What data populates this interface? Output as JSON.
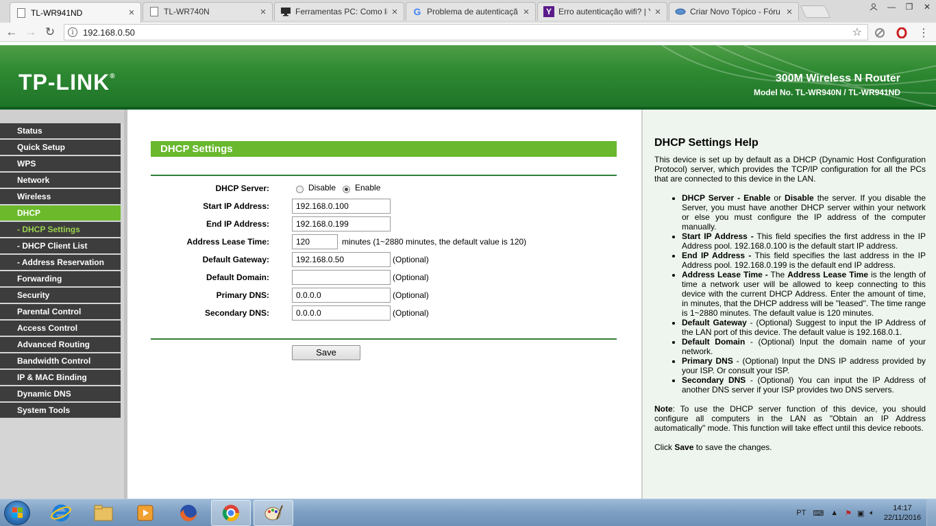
{
  "browser": {
    "tabs": [
      {
        "title": "TL-WR941ND",
        "active": true
      },
      {
        "title": "TL-WR740N",
        "active": false
      },
      {
        "title": "Ferramentas PC: Como li",
        "active": false
      },
      {
        "title": "Problema de autenticaçã",
        "active": false
      },
      {
        "title": "Erro autenticação wifi? | Y",
        "active": false
      },
      {
        "title": "Criar Novo Tópico - Fóru",
        "active": false
      }
    ],
    "address": "192.168.0.50"
  },
  "header": {
    "logo": "TP-LINK",
    "logo_mark": "®",
    "product": "300M Wireless N Router",
    "model": "Model No. TL-WR940N / TL-WR941ND"
  },
  "nav": {
    "items": [
      {
        "label": "Status",
        "sub": false,
        "active": false
      },
      {
        "label": "Quick Setup",
        "sub": false,
        "active": false
      },
      {
        "label": "WPS",
        "sub": false,
        "active": false
      },
      {
        "label": "Network",
        "sub": false,
        "active": false
      },
      {
        "label": "Wireless",
        "sub": false,
        "active": false
      },
      {
        "label": "DHCP",
        "sub": false,
        "active": true
      },
      {
        "label": "- DHCP Settings",
        "sub": true,
        "active": true
      },
      {
        "label": "- DHCP Client List",
        "sub": true,
        "active": false
      },
      {
        "label": "- Address Reservation",
        "sub": true,
        "active": false
      },
      {
        "label": "Forwarding",
        "sub": false,
        "active": false
      },
      {
        "label": "Security",
        "sub": false,
        "active": false
      },
      {
        "label": "Parental Control",
        "sub": false,
        "active": false
      },
      {
        "label": "Access Control",
        "sub": false,
        "active": false
      },
      {
        "label": "Advanced Routing",
        "sub": false,
        "active": false
      },
      {
        "label": "Bandwidth Control",
        "sub": false,
        "active": false
      },
      {
        "label": "IP & MAC Binding",
        "sub": false,
        "active": false
      },
      {
        "label": "Dynamic DNS",
        "sub": false,
        "active": false
      },
      {
        "label": "System Tools",
        "sub": false,
        "active": false
      }
    ]
  },
  "form": {
    "title": "DHCP Settings",
    "dhcp_server_label": "DHCP Server:",
    "disable_label": "Disable",
    "enable_label": "Enable",
    "dhcp_server_value": "Enable",
    "start_ip_label": "Start IP Address:",
    "start_ip": "192.168.0.100",
    "end_ip_label": "End IP Address:",
    "end_ip": "192.168.0.199",
    "lease_label": "Address Lease Time:",
    "lease": "120",
    "lease_note": "minutes (1~2880 minutes, the default value is 120)",
    "gateway_label": "Default Gateway:",
    "gateway": "192.168.0.50",
    "domain_label": "Default Domain:",
    "domain": "",
    "primary_dns_label": "Primary DNS:",
    "primary_dns": "0.0.0.0",
    "secondary_dns_label": "Secondary DNS:",
    "secondary_dns": "0.0.0.0",
    "optional": "(Optional)",
    "save_label": "Save"
  },
  "help": {
    "title": "DHCP Settings Help",
    "intro": "This device is set up by default as a DHCP (Dynamic Host Configuration Protocol) server, which provides the TCP/IP configuration for all the PCs that are connected to this device in the LAN.",
    "items": [
      {
        "term": "DHCP Server - Enable",
        "mid": " or ",
        "term2": "Disable",
        "text": " the server. If you disable the Server, you must have another DHCP server within your network or else you must configure the IP address of the computer manually."
      },
      {
        "term": "Start IP Address -",
        "mid": "",
        "term2": "",
        "text": " This field specifies the first address in the IP Address pool. 192.168.0.100 is the default start IP address."
      },
      {
        "term": "End IP Address -",
        "mid": "",
        "term2": "",
        "text": " This field specifies the last address in the IP Address pool. 192.168.0.199 is the default end IP address."
      },
      {
        "term": "Address Lease Time -",
        "mid": " The ",
        "term2": "Address Lease Time",
        "text": " is the length of time a network user will be allowed to keep connecting to this device with the current DHCP Address. Enter the amount of time, in minutes, that the DHCP address will be \"leased\". The time range is 1~2880 minutes. The default value is 120 minutes."
      },
      {
        "term": "Default Gateway",
        "mid": "",
        "term2": "",
        "text": " - (Optional) Suggest to input the IP Address of the LAN port of this device. The default value is 192.168.0.1."
      },
      {
        "term": "Default Domain",
        "mid": "",
        "term2": "",
        "text": " - (Optional) Input the domain name of your network."
      },
      {
        "term": "Primary DNS",
        "mid": "",
        "term2": "",
        "text": " - (Optional) Input the DNS IP address provided by your ISP. Or consult your ISP."
      },
      {
        "term": "Secondary DNS",
        "mid": "",
        "term2": "",
        "text": " - (Optional) You can input the IP Address of another DNS server if your ISP provides two DNS servers."
      }
    ],
    "note_label": "Note",
    "note": ": To use the DHCP server function of this device, you should configure all computers in the LAN as \"Obtain an IP Address automatically\" mode. This function will take effect until this device reboots.",
    "click_pre": "Click ",
    "click_save": "Save",
    "click_post": " to save the changes."
  },
  "taskbar": {
    "language": "PT",
    "time": "14:17",
    "date": "22/11/2016"
  },
  "colors": {
    "green_header": "#2f8a32",
    "green_active": "#6cba2b",
    "nav_dark": "#3d3d3d"
  }
}
